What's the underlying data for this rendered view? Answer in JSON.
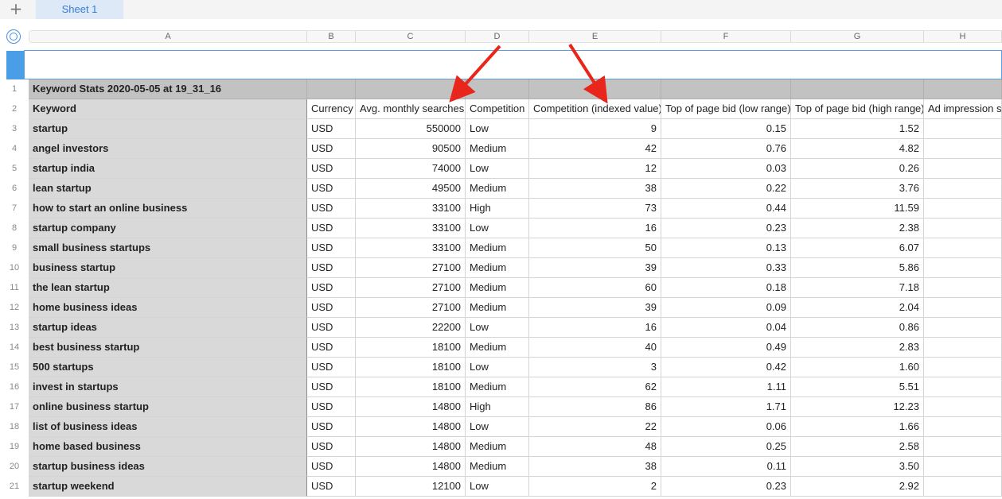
{
  "tabbar": {
    "sheet_tab": "Sheet 1"
  },
  "columns": [
    "A",
    "B",
    "C",
    "D",
    "E",
    "F",
    "G",
    "H"
  ],
  "row_numbers": [
    "1",
    "2",
    "3",
    "4",
    "5",
    "6",
    "7",
    "8",
    "9",
    "10",
    "11",
    "12",
    "13",
    "14",
    "15",
    "16",
    "17",
    "18",
    "19",
    "20",
    "21"
  ],
  "title": "Keyword Stats 2020-05-05 at 19_31_16",
  "headers": [
    "Keyword",
    "Currency",
    "Avg. monthly searches",
    "Competition",
    "Competition (indexed value)",
    "Top of page bid (low range)",
    "Top of page bid (high range)",
    "Ad impression sh"
  ],
  "rows": [
    [
      "startup",
      "USD",
      "550000",
      "Low",
      "9",
      "0.15",
      "1.52"
    ],
    [
      "angel investors",
      "USD",
      "90500",
      "Medium",
      "42",
      "0.76",
      "4.82"
    ],
    [
      "startup india",
      "USD",
      "74000",
      "Low",
      "12",
      "0.03",
      "0.26"
    ],
    [
      "lean startup",
      "USD",
      "49500",
      "Medium",
      "38",
      "0.22",
      "3.76"
    ],
    [
      "how to start an online business",
      "USD",
      "33100",
      "High",
      "73",
      "0.44",
      "11.59"
    ],
    [
      "startup company",
      "USD",
      "33100",
      "Low",
      "16",
      "0.23",
      "2.38"
    ],
    [
      "small business startups",
      "USD",
      "33100",
      "Medium",
      "50",
      "0.13",
      "6.07"
    ],
    [
      "business startup",
      "USD",
      "27100",
      "Medium",
      "39",
      "0.33",
      "5.86"
    ],
    [
      "the lean startup",
      "USD",
      "27100",
      "Medium",
      "60",
      "0.18",
      "7.18"
    ],
    [
      "home business ideas",
      "USD",
      "27100",
      "Medium",
      "39",
      "0.09",
      "2.04"
    ],
    [
      "startup ideas",
      "USD",
      "22200",
      "Low",
      "16",
      "0.04",
      "0.86"
    ],
    [
      "best business startup",
      "USD",
      "18100",
      "Medium",
      "40",
      "0.49",
      "2.83"
    ],
    [
      "500 startups",
      "USD",
      "18100",
      "Low",
      "3",
      "0.42",
      "1.60"
    ],
    [
      "invest in startups",
      "USD",
      "18100",
      "Medium",
      "62",
      "1.11",
      "5.51"
    ],
    [
      "online business startup",
      "USD",
      "14800",
      "High",
      "86",
      "1.71",
      "12.23"
    ],
    [
      "list of business ideas",
      "USD",
      "14800",
      "Low",
      "22",
      "0.06",
      "1.66"
    ],
    [
      "home based business",
      "USD",
      "14800",
      "Medium",
      "48",
      "0.25",
      "2.58"
    ],
    [
      "startup business ideas",
      "USD",
      "14800",
      "Medium",
      "38",
      "0.11",
      "3.50"
    ],
    [
      "startup weekend",
      "USD",
      "12100",
      "Low",
      "2",
      "0.23",
      "2.92"
    ]
  ],
  "colors": {
    "accent": "#3a7bd5",
    "keyword_bg": "#d9d9d9",
    "title_bg": "#c2c2c2",
    "arrow": "#e8261c"
  },
  "icons": {
    "add_sheet": "plus-icon",
    "select_all": "circle-select-icon"
  }
}
